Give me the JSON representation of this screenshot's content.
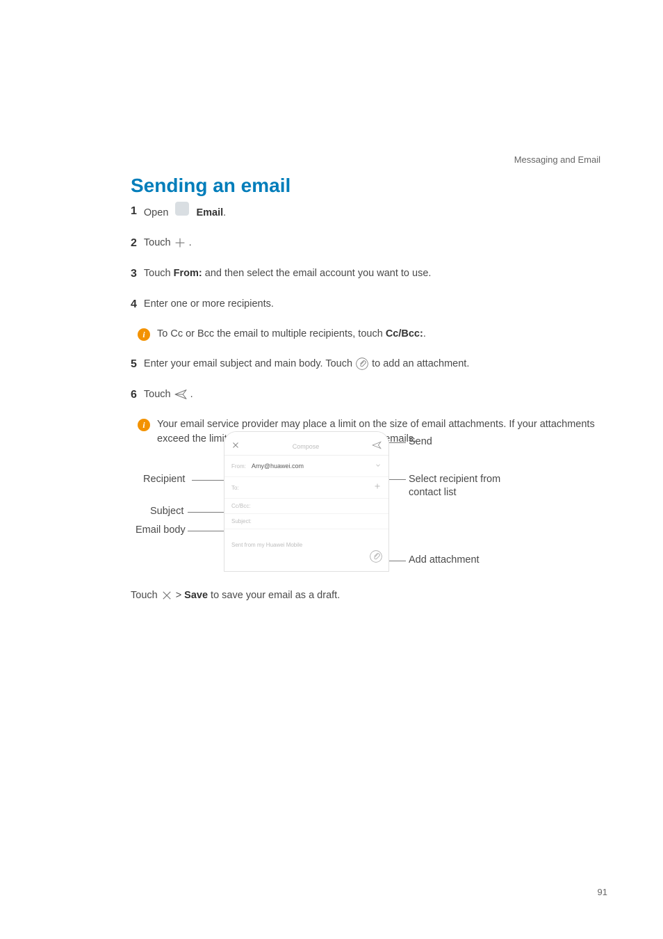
{
  "header": {
    "section": "Messaging and Email"
  },
  "title": "Sending an email",
  "steps": {
    "s1_num": "1",
    "s1_a": "Open ",
    "s1_b": "Email",
    "s1_c": ".",
    "s2_num": "2",
    "s2_a": "Touch ",
    "s2_b": " .",
    "s3_num": "3",
    "s3_a": "Touch ",
    "s3_b": "From:",
    "s3_c": " and then select the email account you want to use.",
    "s4_num": "4",
    "s4_a": "Enter one or more recipients.",
    "note1_a": "To Cc or Bcc the email to multiple recipients, touch ",
    "note1_b": "Cc/Bcc:",
    "note1_c": ".",
    "s5_num": "5",
    "s5_a": "Enter your email subject and main body. Touch ",
    "s5_b": " to add an attachment.",
    "s6_num": "6",
    "s6_a": "Touch ",
    "s6_b": " .",
    "note2": "Your email service provider may place a limit on the size of email attachments. If your attachments exceed the limit, send the attachments in separate emails."
  },
  "phone": {
    "titlebar": "Compose",
    "from_label": "From:",
    "from_value": "Amy@huawei.com",
    "to_label": "To:",
    "ccbcc_label": "Cc/Bcc:",
    "subject_label": "Subject:",
    "signature": "Sent from my Huawei Mobile"
  },
  "callouts": {
    "recipient": "Recipient",
    "subject": "Subject",
    "body": "Email body",
    "send": "Send",
    "select": "Select recipient from contact list",
    "attach": "Add attachment"
  },
  "footer": {
    "a": "Touch ",
    "b": " > ",
    "c": "Save",
    "d": " to save your email as a draft."
  },
  "icons": {
    "info": "i",
    "email": "email-icon",
    "plus": "plus-icon",
    "attachment": "attachment-icon",
    "send": "send-icon",
    "close": "close-icon",
    "chevron": "chevron-down-icon",
    "add_contact": "plus-icon"
  },
  "page_number": "91"
}
